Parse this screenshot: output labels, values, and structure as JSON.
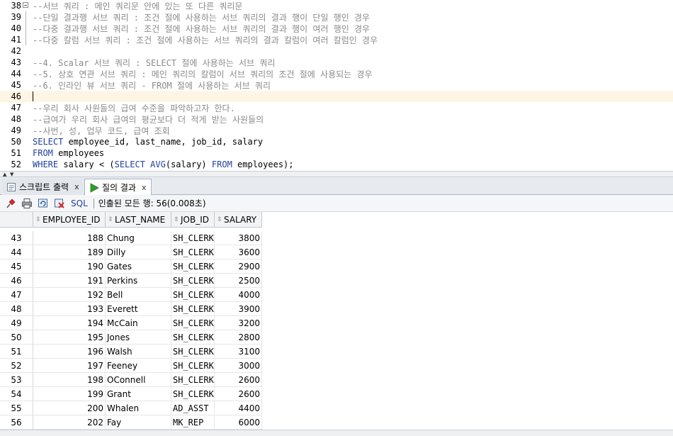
{
  "editor": {
    "lines": [
      {
        "num": "38",
        "fold": "box",
        "parts": [
          {
            "c": "comment",
            "t": "--서브 쿼리 : 메인 쿼리문 안에 있는 또 다른 쿼리문"
          }
        ]
      },
      {
        "num": "39",
        "fold": "line",
        "parts": [
          {
            "c": "comment",
            "t": "--단일 결과행 서브 쿼리 : 조건 절에 사용하는 서브 쿼리의 결과 행이 단일 행인 경우"
          }
        ]
      },
      {
        "num": "40",
        "fold": "line",
        "parts": [
          {
            "c": "comment",
            "t": "--다중 결과행 서브 쿼리 : 조건 절에 사용하는 서브 쿼리의 결과 행이 여러 행인 경우"
          }
        ]
      },
      {
        "num": "41",
        "fold": "line",
        "parts": [
          {
            "c": "comment",
            "t": "--다중 칼럼 서브 쿼리 : 조건 절에 사용하는 서브 쿼리의 결과 칼럼이 여러 칼럼인 경우"
          }
        ]
      },
      {
        "num": "42",
        "fold": "",
        "parts": []
      },
      {
        "num": "43",
        "fold": "",
        "parts": [
          {
            "c": "comment",
            "t": "--4. Scalar 서브 쿼리 : SELECT 절에 사용하는 서브 쿼리"
          }
        ]
      },
      {
        "num": "44",
        "fold": "",
        "parts": [
          {
            "c": "comment",
            "t": "--5. 상호 연관 서브 쿼리 : 메인 쿼리의 칼럼이 서브 쿼리의 조건 절에 사용되는 경우"
          }
        ]
      },
      {
        "num": "45",
        "fold": "",
        "parts": [
          {
            "c": "comment",
            "t": "--6. 인라인 뷰 서브 쿼리 - FROM 절에 사용하는 서브 쿼리"
          }
        ]
      },
      {
        "num": "46",
        "fold": "",
        "current": true,
        "parts": []
      },
      {
        "num": "47",
        "fold": "",
        "parts": [
          {
            "c": "comment",
            "t": "--우리 회사 사원들의 급여 수준을 파악하고자 한다."
          }
        ]
      },
      {
        "num": "48",
        "fold": "",
        "parts": [
          {
            "c": "comment",
            "t": "--급여가 우리 회사 급여의 평균보다 더 적게 받는 사원들의"
          }
        ]
      },
      {
        "num": "49",
        "fold": "",
        "parts": [
          {
            "c": "comment",
            "t": "--사번, 성, 업무 코드, 급여 조회"
          }
        ]
      },
      {
        "num": "50",
        "fold": "",
        "parts": [
          {
            "c": "kw",
            "t": "SELECT"
          },
          {
            "c": "ident",
            "t": " employee_id, last_name, job_id, salary"
          }
        ]
      },
      {
        "num": "51",
        "fold": "",
        "parts": [
          {
            "c": "kw",
            "t": "FROM"
          },
          {
            "c": "ident",
            "t": " employees"
          }
        ]
      },
      {
        "num": "52",
        "fold": "",
        "parts": [
          {
            "c": "kw",
            "t": "WHERE"
          },
          {
            "c": "ident",
            "t": " salary < ("
          },
          {
            "c": "kw",
            "t": "SELECT AVG"
          },
          {
            "c": "ident",
            "t": "(salary) "
          },
          {
            "c": "kw",
            "t": "FROM"
          },
          {
            "c": "ident",
            "t": " employees);"
          }
        ]
      }
    ]
  },
  "tabs": [
    {
      "label": "스크립트 출력",
      "close": "x",
      "icon": "script-output-icon",
      "active": false
    },
    {
      "label": "질의 결과",
      "close": "x",
      "icon": "run-icon",
      "active": true
    }
  ],
  "toolbar": {
    "sql_label": "SQL",
    "separator": "|",
    "status": "인출된 모든 행: 56(0.008초)",
    "icons": [
      "pin-icon",
      "print-icon",
      "refresh-icon",
      "delete-icon"
    ]
  },
  "grid": {
    "columns": [
      "EMPLOYEE_ID",
      "LAST_NAME",
      "JOB_ID",
      "SALARY"
    ],
    "rows": [
      {
        "rn": "43",
        "id": "188",
        "ln": "Chung",
        "job": "SH_CLERK",
        "sal": "3800"
      },
      {
        "rn": "44",
        "id": "189",
        "ln": "Dilly",
        "job": "SH_CLERK",
        "sal": "3600"
      },
      {
        "rn": "45",
        "id": "190",
        "ln": "Gates",
        "job": "SH_CLERK",
        "sal": "2900"
      },
      {
        "rn": "46",
        "id": "191",
        "ln": "Perkins",
        "job": "SH_CLERK",
        "sal": "2500"
      },
      {
        "rn": "47",
        "id": "192",
        "ln": "Bell",
        "job": "SH_CLERK",
        "sal": "4000"
      },
      {
        "rn": "48",
        "id": "193",
        "ln": "Everett",
        "job": "SH_CLERK",
        "sal": "3900"
      },
      {
        "rn": "49",
        "id": "194",
        "ln": "McCain",
        "job": "SH_CLERK",
        "sal": "3200"
      },
      {
        "rn": "50",
        "id": "195",
        "ln": "Jones",
        "job": "SH_CLERK",
        "sal": "2800"
      },
      {
        "rn": "51",
        "id": "196",
        "ln": "Walsh",
        "job": "SH_CLERK",
        "sal": "3100"
      },
      {
        "rn": "52",
        "id": "197",
        "ln": "Feeney",
        "job": "SH_CLERK",
        "sal": "3000"
      },
      {
        "rn": "53",
        "id": "198",
        "ln": "OConnell",
        "job": "SH_CLERK",
        "sal": "2600"
      },
      {
        "rn": "54",
        "id": "199",
        "ln": "Grant",
        "job": "SH_CLERK",
        "sal": "2600"
      },
      {
        "rn": "55",
        "id": "200",
        "ln": "Whalen",
        "job": "AD_ASST",
        "sal": "4400"
      },
      {
        "rn": "56",
        "id": "202",
        "ln": "Fay",
        "job": "MK_REP",
        "sal": "6000"
      }
    ]
  },
  "colors": {
    "keyword": "#1f3fa0",
    "comment": "#8a8a8a",
    "current_line": "#fdf6e4",
    "run_green": "#2e9e2e",
    "pin_red": "#d42a2a"
  }
}
